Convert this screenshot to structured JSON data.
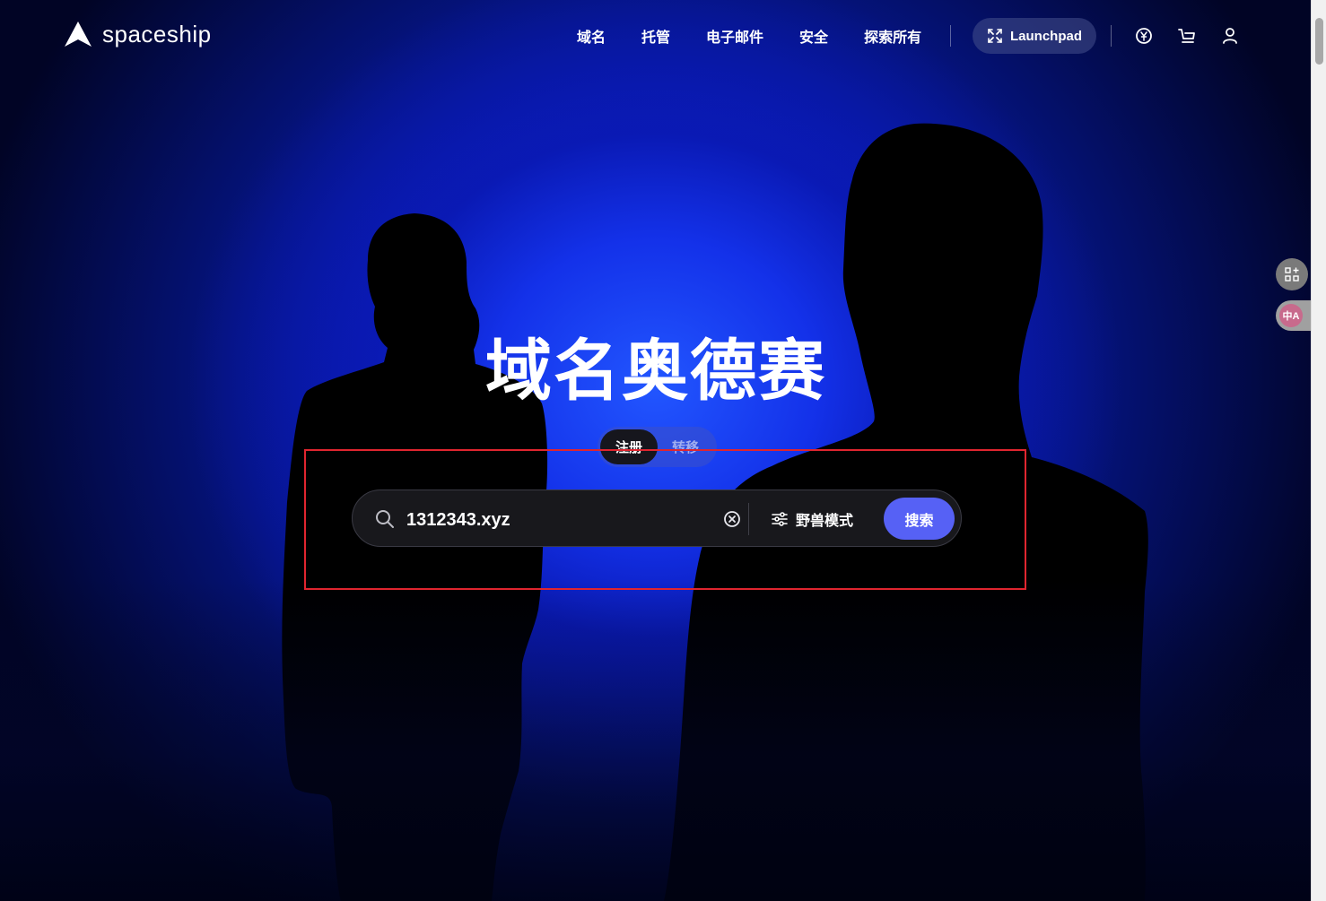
{
  "brand": {
    "name": "spaceship"
  },
  "nav": {
    "items": [
      "域名",
      "托管",
      "电子邮件",
      "安全",
      "探索所有"
    ],
    "launchpad_label": "Launchpad"
  },
  "hero": {
    "title": "域名奥德赛"
  },
  "mode_toggle": {
    "active": "注册",
    "inactive": "转移"
  },
  "search": {
    "value": "1312343.xyz",
    "beast_mode_label": "野兽模式",
    "button_label": "搜索"
  },
  "side_widgets": {
    "translate_label": "中A"
  },
  "colors": {
    "accent": "#5661f5",
    "highlight": "#e0252f",
    "background_blue": "#0a22d8"
  }
}
